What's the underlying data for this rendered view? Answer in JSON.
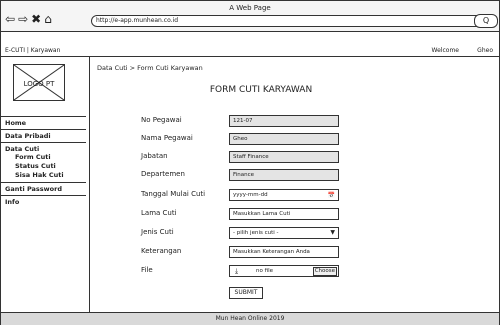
{
  "browser": {
    "window_title": "A Web Page",
    "address": "http://e-app.munhean.co.id",
    "search_icon_label": "Q"
  },
  "header": {
    "app_name": "E-CUTI | Karyawan",
    "welcome": "Welcome",
    "user": "Gheo"
  },
  "logo": {
    "text": "LOGO PT"
  },
  "sidebar": {
    "home": "Home",
    "data_pribadi": "Data Pribadi",
    "data_cuti": "Data Cuti",
    "sub": [
      "Form Cuti",
      "Status Cuti",
      "Sisa Hak Cuti"
    ],
    "ganti_password": "Ganti Password",
    "info": "Info"
  },
  "breadcrumb": "Data Cuti > Form Cuti Karyawan",
  "form": {
    "title": "FORM CUTI KARYAWAN",
    "no_pegawai": {
      "label": "No Pegawai",
      "value": "121-07"
    },
    "nama_pegawai": {
      "label": "Nama Pegawai",
      "value": "Gheo"
    },
    "jabatan": {
      "label": "Jabatan",
      "value": "Staff Finance"
    },
    "departemen": {
      "label": "Departemen",
      "value": "Finance"
    },
    "tanggal_mulai": {
      "label": "Tanggal Mulai Cuti",
      "placeholder": "yyyy-mm-dd"
    },
    "lama_cuti": {
      "label": "Lama Cuti",
      "placeholder": "Masukkan Lama Cuti"
    },
    "jenis_cuti": {
      "label": "Jenis Cuti",
      "selected": "- pilih jenis cuti -"
    },
    "keterangan": {
      "label": "Keterangan",
      "placeholder": "Masukkan Keterangan Anda"
    },
    "file": {
      "label": "File",
      "status": "no file",
      "choose": "Choose"
    },
    "submit": "SUBMIT"
  },
  "footer": "Mun Hean Online 2019"
}
